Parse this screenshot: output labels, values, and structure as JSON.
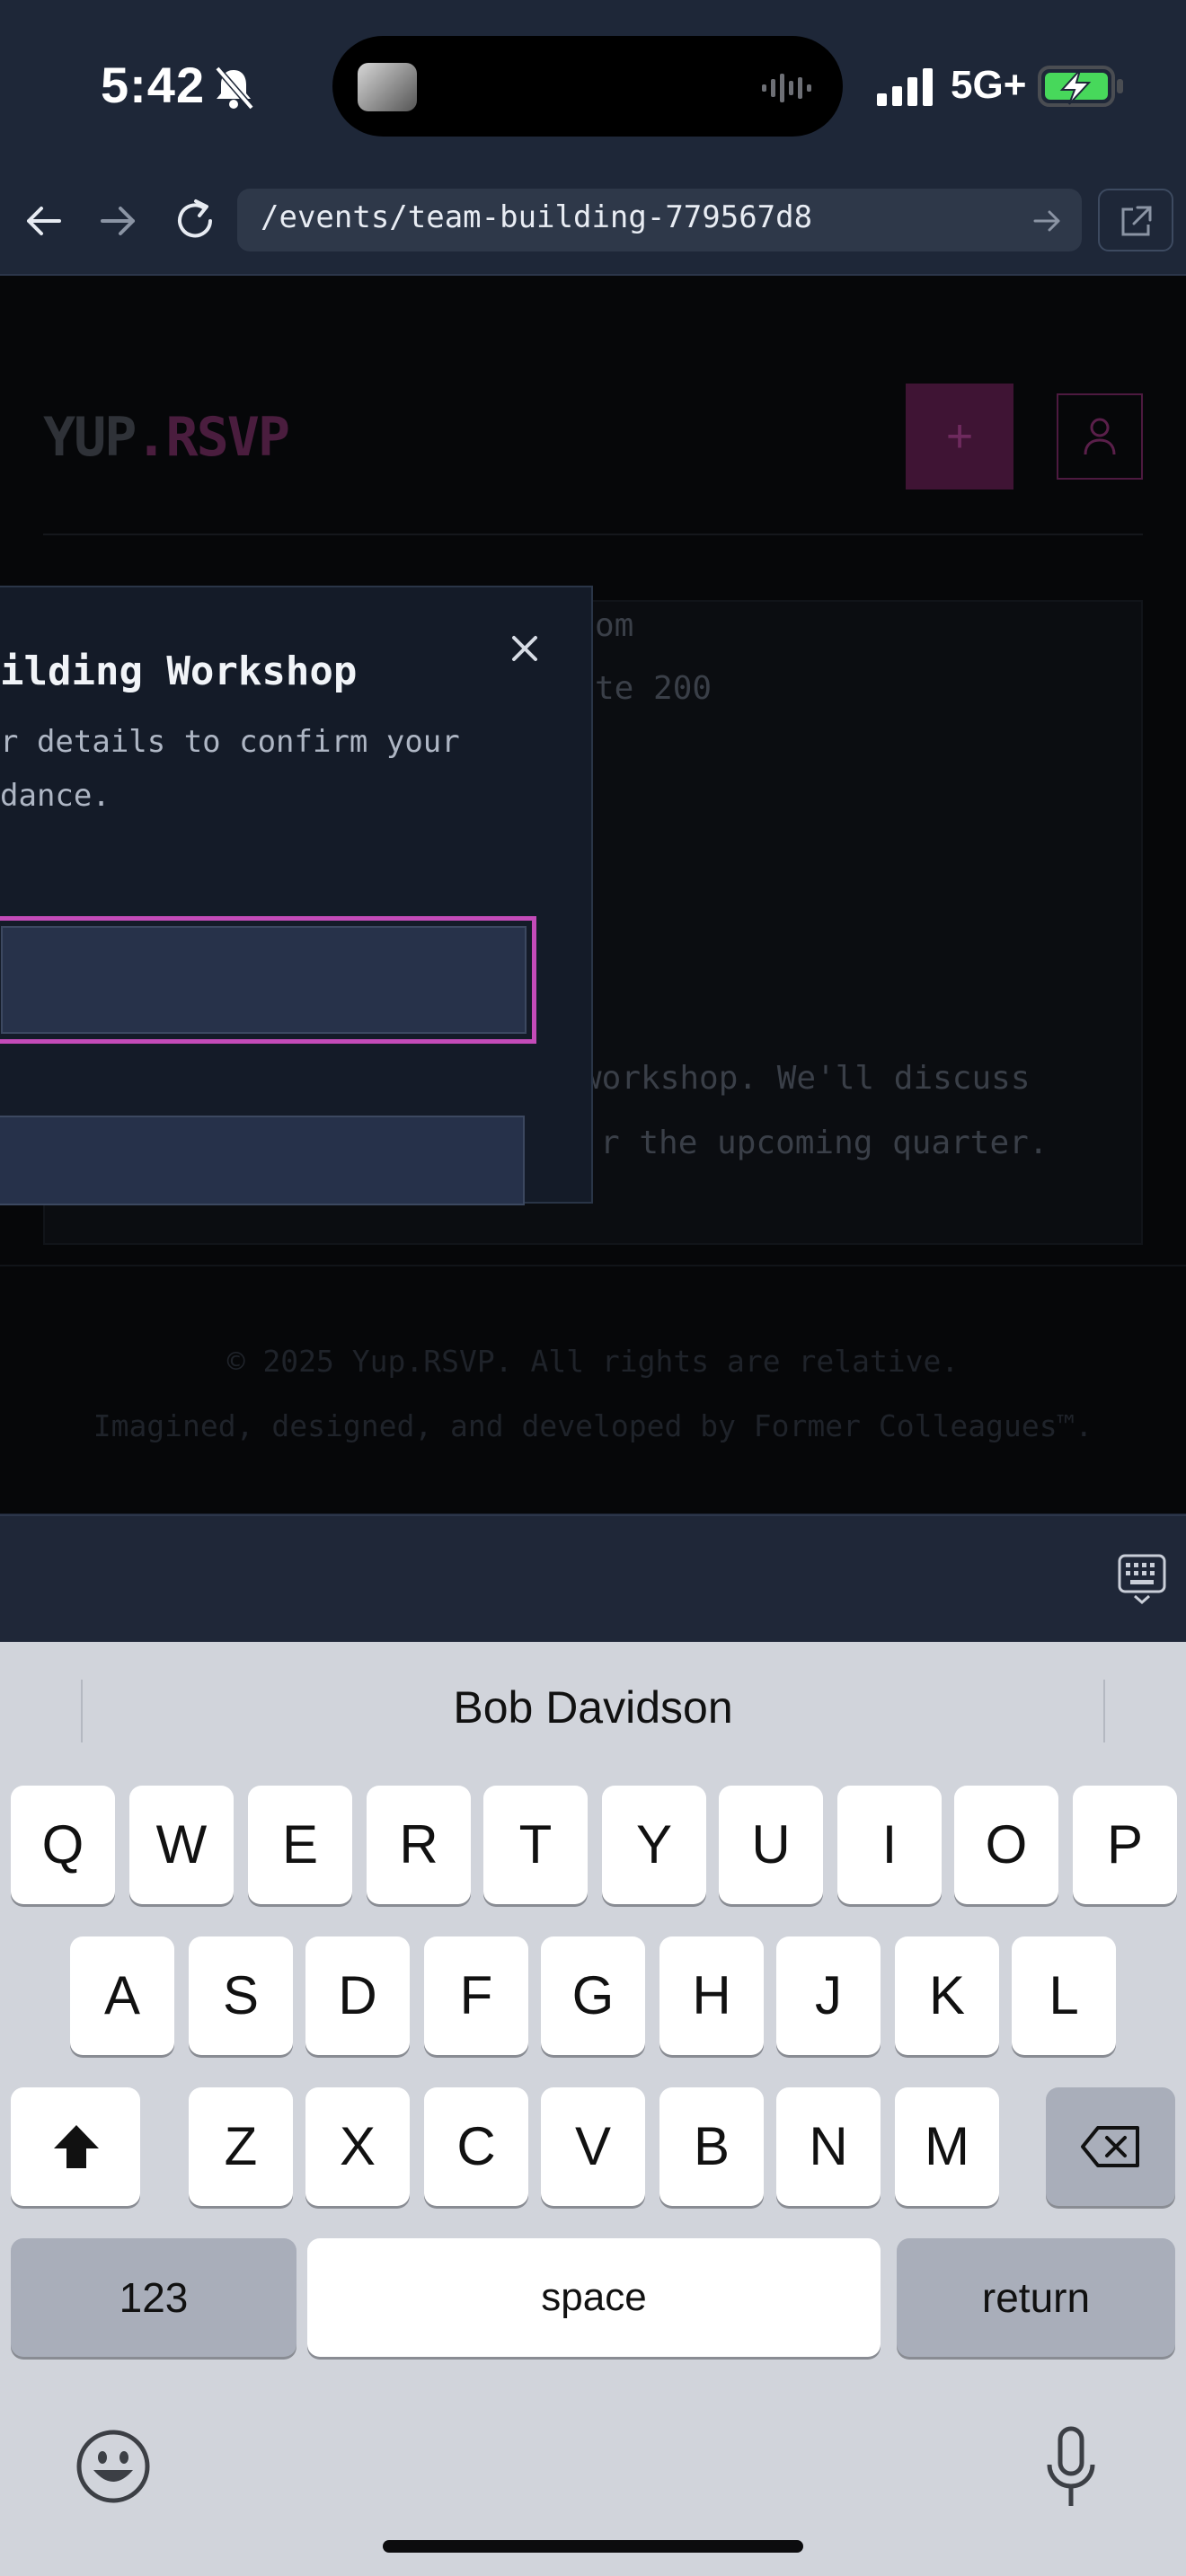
{
  "status_bar": {
    "time": "5:42",
    "network": "5G+",
    "icons": [
      "bell-slash-icon",
      "signal-bars-icon",
      "battery-charging-icon",
      "waveform-icon"
    ]
  },
  "browser": {
    "url": "/events/team-building-779567d8",
    "icons": [
      "back-arrow-icon",
      "forward-arrow-icon",
      "reload-icon",
      "go-arrow-icon",
      "external-link-icon"
    ]
  },
  "site": {
    "logo_part1": "YUP",
    "logo_part2": ".RSVP",
    "add_symbol": "+",
    "card_line1": "om",
    "card_line2": "te 200",
    "desc_line1": " workshop. We'll discuss",
    "desc_line2": "r the upcoming quarter.",
    "footer_line1": "© 2025 Yup.RSVP. All rights are relative.",
    "footer_line2": "Imagined, designed, and developed by Former Colleagues™."
  },
  "modal": {
    "title": "ilding Workshop",
    "subtitle_line1": "r details to confirm your",
    "subtitle_line2": "dance.",
    "close_symbol": "×"
  },
  "keyboard": {
    "suggestion": "Bob Davidson",
    "row1": [
      "Q",
      "W",
      "E",
      "R",
      "T",
      "Y",
      "U",
      "I",
      "O",
      "P"
    ],
    "row2": [
      "A",
      "S",
      "D",
      "F",
      "G",
      "H",
      "J",
      "K",
      "L"
    ],
    "row3": [
      "Z",
      "X",
      "C",
      "V",
      "B",
      "N",
      "M"
    ],
    "numbers_label": "123",
    "space_label": "space",
    "return_label": "return"
  },
  "colors": {
    "accent": "#c44bb9",
    "page_bg": "#060709",
    "keyboard_bg": "#d1d4db"
  }
}
